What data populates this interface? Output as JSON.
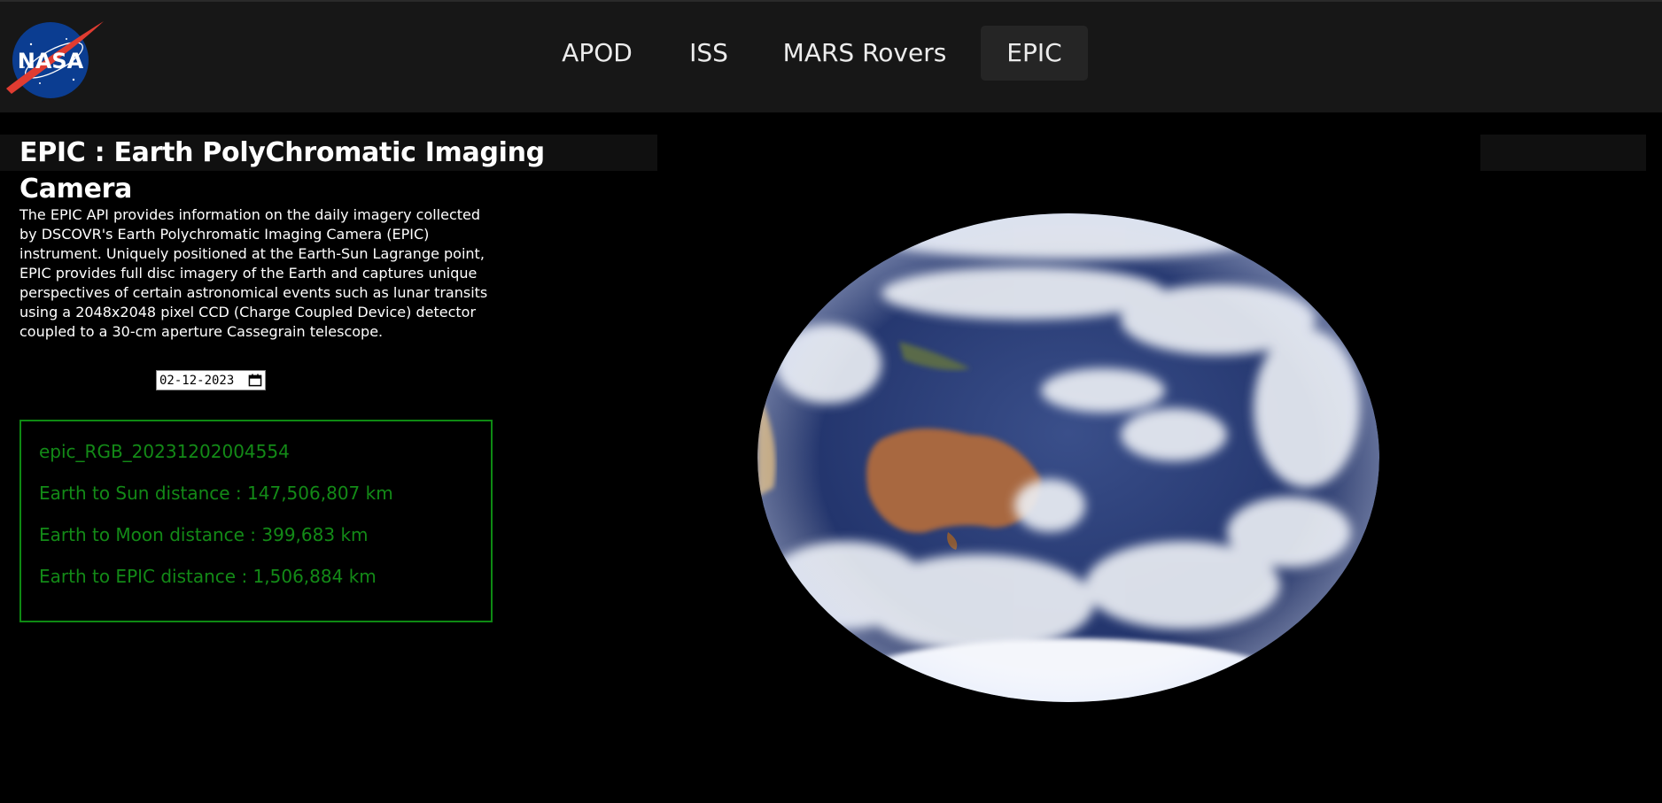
{
  "header": {
    "logo_alt": "NASA",
    "nav": [
      {
        "label": "APOD",
        "active": false
      },
      {
        "label": "ISS",
        "active": false
      },
      {
        "label": "MARS Rovers",
        "active": false
      },
      {
        "label": "EPIC",
        "active": true
      }
    ]
  },
  "main": {
    "title": "EPIC : Earth PolyChromatic Imaging Camera",
    "description": "The EPIC API provides information on the daily imagery collected by DSCOVR's Earth Polychromatic Imaging Camera (EPIC) instrument. Uniquely positioned at the Earth-Sun Lagrange point, EPIC provides full disc imagery of the Earth and captures unique perspectives of certain astronomical events such as lunar transits using a 2048x2048 pixel CCD (Charge Coupled Device) detector coupled to a 30-cm aperture Cassegrain telescope.",
    "date_value": "02-12-2023",
    "info": {
      "image_name": "epic_RGB_20231202004554",
      "sun_distance": "Earth to Sun distance : 147,506,807 km",
      "moon_distance": "Earth to Moon distance : 399,683 km",
      "epic_distance": "Earth to EPIC distance : 1,506,884 km"
    }
  },
  "colors": {
    "background": "#000000",
    "header_bg": "#171717",
    "active_nav_bg": "#252525",
    "info_green": "#138a17"
  },
  "icons": {
    "logo": "nasa-logo",
    "date_picker": "calendar-icon"
  }
}
